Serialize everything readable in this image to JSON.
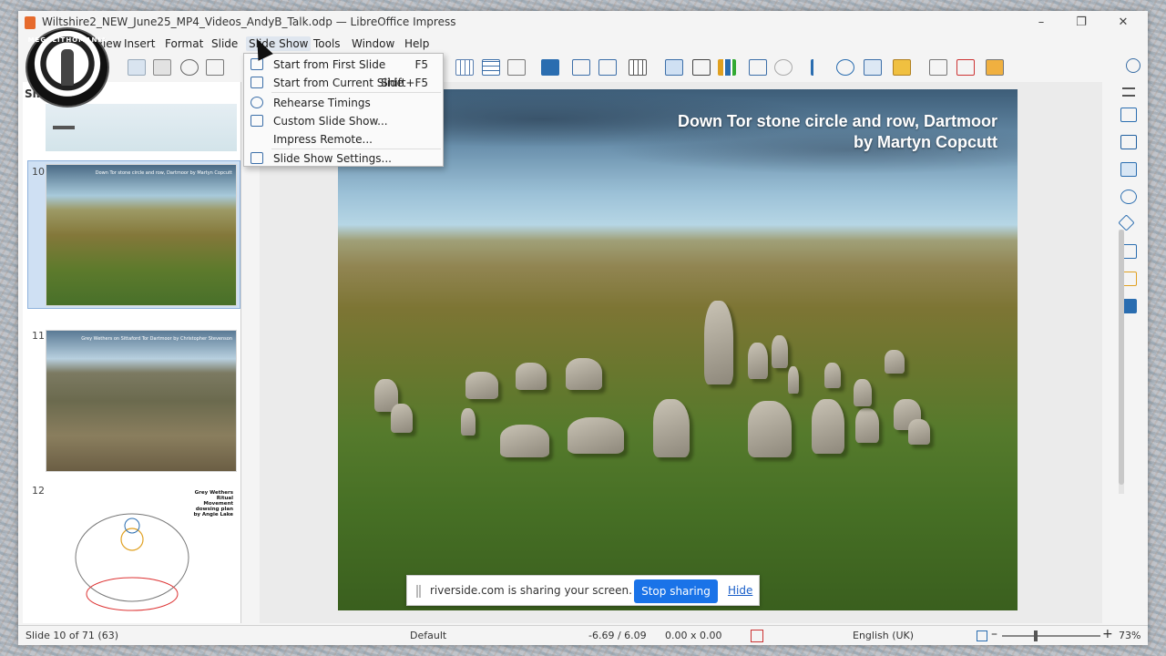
{
  "window": {
    "title": "Wiltshire2_NEW_June25_MP4_Videos_AndyB_Talk.odp — LibreOffice Impress",
    "minimize": "–",
    "restore": "❐",
    "close": "✕"
  },
  "menubar": [
    "View",
    "Insert",
    "Format",
    "Slide",
    "Slide Show",
    "Tools",
    "Window",
    "Help"
  ],
  "slide_panel": {
    "title": "Sli",
    "items": [
      {
        "num": "10",
        "title": "Down Tor stone circle and row, Dartmoor by Martyn Copcutt"
      },
      {
        "num": "11",
        "title": "Grey Wethers on Sittaford Tor Dartmoor by Christopher Stevenson"
      },
      {
        "num": "12",
        "title": "Grey Wethers Ritual Movement dowsing plan by Angie Lake"
      }
    ]
  },
  "dropdown": {
    "items": [
      {
        "label": "Start from First Slide",
        "shortcut": "F5"
      },
      {
        "label": "Start from Current Slide",
        "shortcut": "Shift+F5"
      },
      {
        "label": "Rehearse Timings",
        "shortcut": ""
      },
      {
        "label": "Custom Slide Show...",
        "shortcut": ""
      },
      {
        "label": "Impress Remote...",
        "shortcut": ""
      },
      {
        "label": "Slide Show Settings...",
        "shortcut": ""
      }
    ]
  },
  "slide": {
    "title_line1": "Down Tor stone circle and row, Dartmoor",
    "title_line2": "by Martyn Copcutt"
  },
  "share_bar": {
    "text": "riverside.com is sharing your screen.",
    "stop": "Stop sharing",
    "hide": "Hide"
  },
  "status": {
    "slide": "Slide 10 of 71 (63)",
    "layout": "Default",
    "position": "-6.69 / 6.09",
    "size": "0.00 x 0.00",
    "language": "English (UK)",
    "zoom": "73%",
    "zoom_fraction": 0.73
  },
  "logo": {
    "text": "MEGALITHOMANIA"
  }
}
